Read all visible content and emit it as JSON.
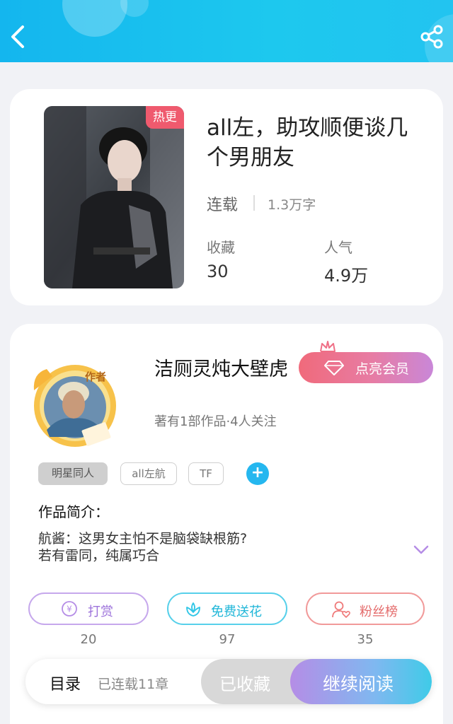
{
  "header": {
    "back_icon": "chevron-left-icon",
    "share_icon": "share-icon"
  },
  "book": {
    "hot_badge": "热更",
    "title": "all左，助攻顺便谈几个男朋友",
    "status": "连载",
    "word_count": "1.3万字",
    "collect_label": "收藏",
    "collect_value": "30",
    "popularity_label": "人气",
    "popularity_value": "4.9万"
  },
  "author": {
    "avatar_badge": "作者",
    "name": "洁厕灵炖大壁虎",
    "vip_button": "点亮会员",
    "meta": "著有1部作品·4人关注",
    "tags": [
      "明星同人",
      "all左航",
      "TF"
    ],
    "add_tag": "+",
    "intro_title": "作品简介：",
    "intro_line1": "航酱：这男女主怕不是脑袋缺根筋?",
    "intro_line2": "若有雷同，纯属巧合"
  },
  "actions": [
    {
      "label": "打赏",
      "count": "20",
      "color": "#b58de6",
      "icon": "yen-coin-icon"
    },
    {
      "label": "免费送花",
      "count": "97",
      "color": "#2fc6e6",
      "icon": "flower-icon"
    },
    {
      "label": "粉丝榜",
      "count": "35",
      "color": "#ef7a7a",
      "icon": "fan-person-icon"
    }
  ],
  "bottom_bar": {
    "toc": "目录",
    "chapters": "已连载11章",
    "collected": "已收藏",
    "continue_read": "继续阅读"
  }
}
